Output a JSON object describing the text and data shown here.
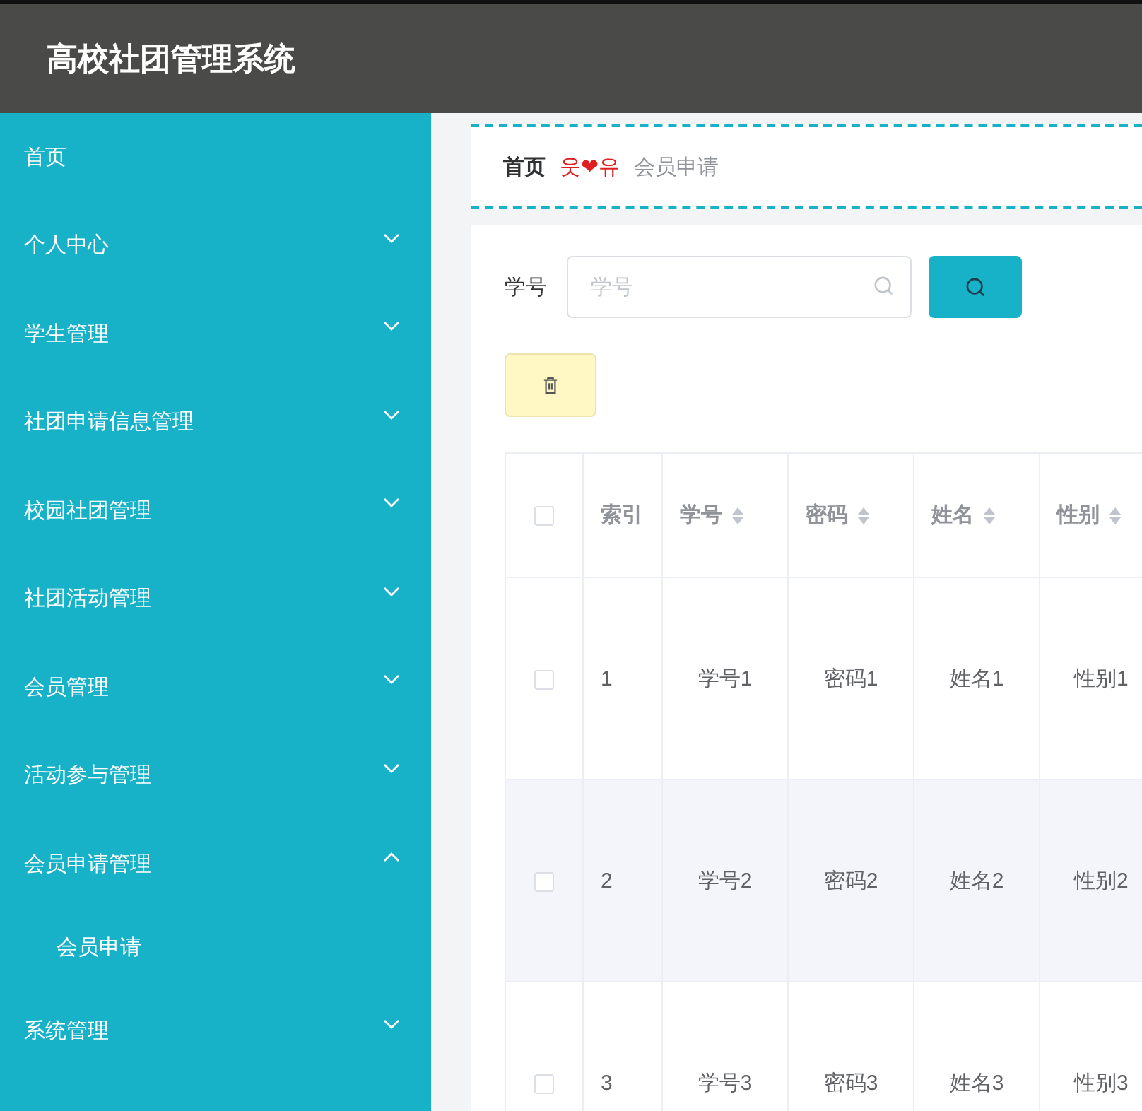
{
  "header": {
    "title": "高校社团管理系统"
  },
  "sidebar": {
    "items": [
      {
        "kind": "link",
        "label": "首页"
      },
      {
        "kind": "menu",
        "label": "个人中心",
        "expanded": false
      },
      {
        "kind": "menu",
        "label": "学生管理",
        "expanded": false
      },
      {
        "kind": "menu",
        "label": "社团申请信息管理",
        "expanded": false
      },
      {
        "kind": "menu",
        "label": "校园社团管理",
        "expanded": false
      },
      {
        "kind": "menu",
        "label": "社团活动管理",
        "expanded": false
      },
      {
        "kind": "menu",
        "label": "会员管理",
        "expanded": false
      },
      {
        "kind": "menu",
        "label": "活动参与管理",
        "expanded": false
      },
      {
        "kind": "menu",
        "label": "会员申请管理",
        "expanded": true,
        "children": [
          {
            "label": "会员申请"
          }
        ]
      },
      {
        "kind": "menu",
        "label": "系统管理",
        "expanded": false
      }
    ]
  },
  "breadcrumb": {
    "items": [
      "首页",
      "会员申请"
    ],
    "separator": "웃❤유"
  },
  "search": {
    "label": "学号",
    "placeholder": "学号"
  },
  "table": {
    "select_all": {
      "checked": false
    },
    "columns": [
      {
        "kind": "text",
        "label": "索引"
      },
      {
        "kind": "sortable",
        "label": "学号"
      },
      {
        "kind": "sortable",
        "label": "密码"
      },
      {
        "kind": "sortable",
        "label": "姓名"
      },
      {
        "kind": "sortable",
        "label": "性别"
      }
    ],
    "rows": [
      {
        "selected": false,
        "cells": [
          "1",
          "学号1",
          "密码1",
          "姓名1",
          "性别1"
        ]
      },
      {
        "selected": false,
        "cells": [
          "2",
          "学号2",
          "密码2",
          "姓名2",
          "性别2"
        ]
      },
      {
        "selected": false,
        "cells": [
          "3",
          "学号3",
          "密码3",
          "姓名3",
          "性别3"
        ]
      }
    ]
  }
}
